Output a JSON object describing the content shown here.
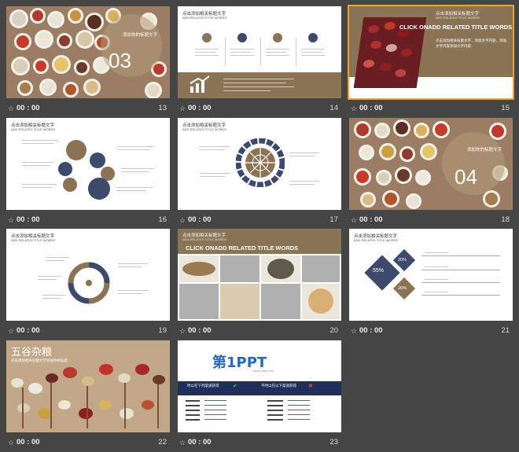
{
  "colors": {
    "accent": "#8b7355",
    "dark_blue": "#3d4a6b",
    "bg": "#454545"
  },
  "slides": [
    {
      "number": "13",
      "time": "00 : 00",
      "big_num": "03",
      "caption": "添加你的标题文字"
    },
    {
      "number": "14",
      "time": "00 : 00",
      "title": "点击添加相关标题文字",
      "subtitle": "ADD RELATED TITLE WORDS"
    },
    {
      "number": "15",
      "time": "00 : 00",
      "title": "点击添加相关标题文字",
      "subtitle": "ADD RELATED TITLE WORDS",
      "banner": "CLICK ONADD RELATED TITLE WORDS",
      "body": "点击添加相关标题文字，添加文字内容，添加文字内容添加文字内容"
    },
    {
      "number": "16",
      "time": "00 : 00",
      "title": "点击添加相关标题文字",
      "subtitle": "ADD RELATED TITLE WORDS"
    },
    {
      "number": "17",
      "time": "00 : 00",
      "title": "点击添加相关标题文字",
      "subtitle": "ADD RELATED TITLE WORDS"
    },
    {
      "number": "18",
      "time": "00 : 00",
      "big_num": "04",
      "caption": "添加你的标题文字"
    },
    {
      "number": "19",
      "time": "00 : 00",
      "title": "点击添加相关标题文字",
      "subtitle": "ADD RELATED TITLE WORDS"
    },
    {
      "number": "20",
      "time": "00 : 00",
      "title": "点击添加相关标题文字",
      "subtitle": "ADD RELATED TITLE WORDS",
      "banner": "CLICK ONADD RELATED TITLE WORDS"
    },
    {
      "number": "21",
      "time": "00 : 00",
      "title": "点击添加相关标题文字",
      "subtitle": "ADD RELATED TITLE WORDS",
      "pct1": "55%",
      "pct2": "20%",
      "pct3": "26%"
    },
    {
      "number": "22",
      "time": "00 : 00",
      "title": "五谷杂粮",
      "subtitle": "点击添加相关标题文字添加你的标题"
    },
    {
      "number": "23",
      "time": "00 : 00",
      "logo": "第1PPT",
      "logo_url": "www.1ppt.com",
      "left_head": "时以在下列渠道获得",
      "right_head": "不时以在以下渠道获得"
    }
  ]
}
